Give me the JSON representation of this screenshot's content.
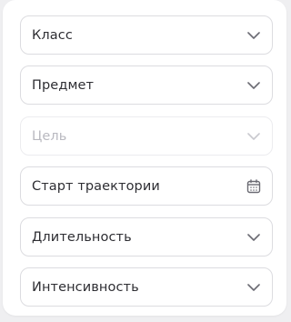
{
  "fields": [
    {
      "label": "Класс",
      "icon": "chevron-down-icon",
      "disabled": false
    },
    {
      "label": "Предмет",
      "icon": "chevron-down-icon",
      "disabled": false
    },
    {
      "label": "Цель",
      "icon": "chevron-down-icon",
      "disabled": true
    },
    {
      "label": "Старт траектории",
      "icon": "calendar-icon",
      "disabled": false
    },
    {
      "label": "Длительность",
      "icon": "chevron-down-icon",
      "disabled": false
    },
    {
      "label": "Интенсивность",
      "icon": "chevron-down-icon",
      "disabled": false
    }
  ],
  "colors": {
    "text": "#2e2e33",
    "disabled_text": "#b9b9c0",
    "border": "#dcdce0",
    "icon": "#6b6b73",
    "disabled_icon": "#c9c9cf"
  }
}
